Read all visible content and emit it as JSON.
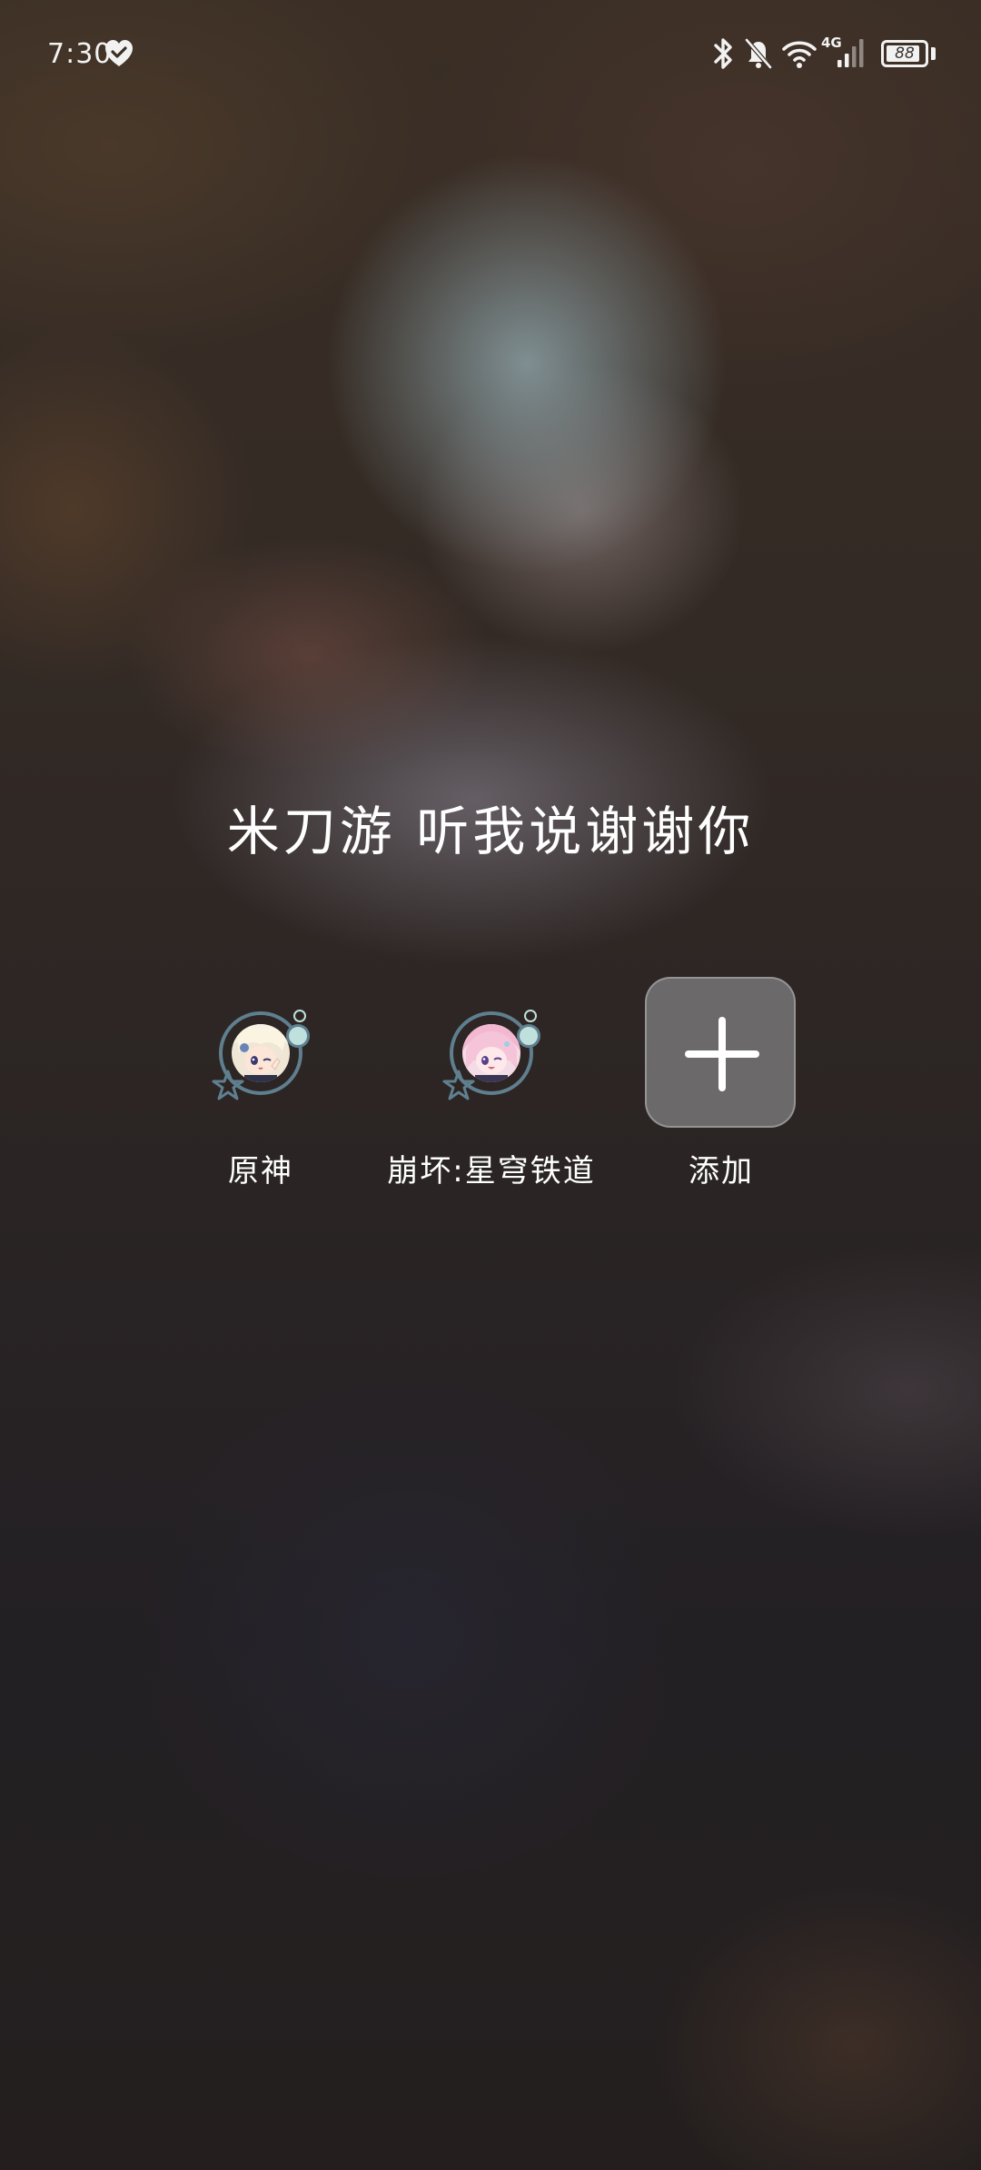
{
  "status_bar": {
    "time": "7:30",
    "network_type": "4G",
    "battery_level": "88",
    "icons": [
      "heart-icon",
      "bluetooth-icon",
      "bell-muted-icon",
      "wifi-icon",
      "signal-icon",
      "battery-icon"
    ]
  },
  "message": "米刀游 听我说谢谢你",
  "shortcuts": [
    {
      "label": "原神",
      "icon": "genshin-avatar-icon"
    },
    {
      "label": "崩坏:星穹铁道",
      "icon": "starrail-avatar-icon"
    },
    {
      "label": "添加",
      "icon": "plus-icon"
    }
  ],
  "colors": {
    "text": "#ffffff",
    "ring": "#5f7f8f",
    "accent_dot": "#bfe0dc",
    "add_tile": "#787678"
  }
}
